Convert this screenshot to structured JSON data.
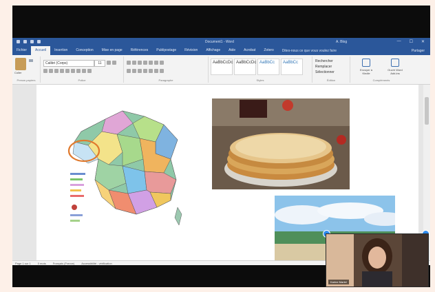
{
  "window": {
    "doc_title": "Document1 - Word",
    "user": "A. Blog",
    "controls": [
      "—",
      "☐",
      "✕"
    ]
  },
  "tabs": [
    {
      "label": "Fichier"
    },
    {
      "label": "Accueil"
    },
    {
      "label": "Insertion"
    },
    {
      "label": "Conception"
    },
    {
      "label": "Mise en page"
    },
    {
      "label": "Références"
    },
    {
      "label": "Publipostage"
    },
    {
      "label": "Révision"
    },
    {
      "label": "Affichage"
    },
    {
      "label": "Aide"
    },
    {
      "label": "Acrobat"
    },
    {
      "label": "Zotero"
    }
  ],
  "tell_me": "Dites-nous ce que vous voulez faire",
  "share": "Partager",
  "ribbon": {
    "paste_label": "Coller",
    "font_name": "Calibri (Corps)",
    "font_size": "11",
    "groups": {
      "clipboard": "Presse-papiers",
      "font": "Police",
      "paragraph": "Paragraphe",
      "styles": "Styles",
      "edit": "Édition",
      "addins": "Compléments"
    },
    "styles": [
      "AaBbCcDc",
      "AaBbCcDc",
      "AaBbCc",
      "AaBbCc"
    ],
    "edit_items": [
      "Rechercher",
      "Remplacer",
      "Sélectionner"
    ],
    "addins": [
      "Envoyer à Kindle",
      "Ouvrir Word Add-ins"
    ]
  },
  "status_bar": [
    "Page 1 sur 1",
    "0 mots",
    "Français (France)",
    "Accessibilité : vérification"
  ],
  "images": {
    "map": "map-of-france-regions",
    "crepe": "stack-of-crepes",
    "beach": "beach-with-sky"
  },
  "webcam": {
    "participant_name": "Karine Martel"
  }
}
